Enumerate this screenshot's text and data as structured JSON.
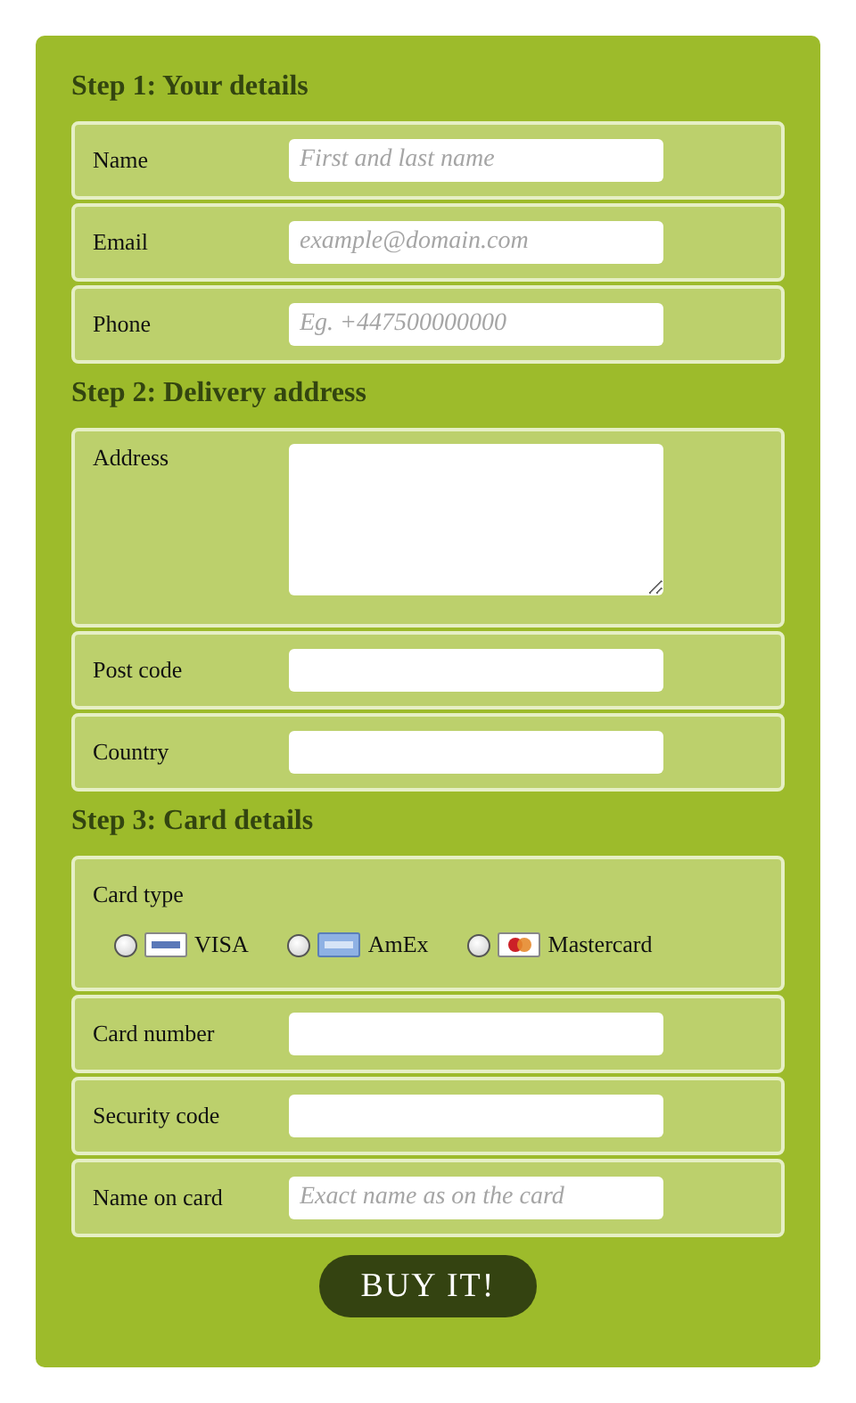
{
  "sections": [
    {
      "title": "Step 1: Your details",
      "rows": [
        {
          "kind": "text",
          "label": "Name",
          "placeholder": "First and last name"
        },
        {
          "kind": "text",
          "label": "Email",
          "placeholder": "example@domain.com"
        },
        {
          "kind": "text",
          "label": "Phone",
          "placeholder": "Eg. +447500000000"
        }
      ]
    },
    {
      "title": "Step 2: Delivery address",
      "rows": [
        {
          "kind": "textarea",
          "label": "Address"
        },
        {
          "kind": "text",
          "label": "Post code"
        },
        {
          "kind": "text",
          "label": "Country"
        }
      ]
    },
    {
      "title": "Step 3: Card details",
      "rows": [
        {
          "kind": "radio",
          "label": "Card type",
          "options": [
            {
              "label": "VISA",
              "kind": "visa",
              "selected": false
            },
            {
              "label": "AmEx",
              "kind": "amex",
              "selected": false
            },
            {
              "label": "Mastercard",
              "kind": "mastercard",
              "selected": false
            }
          ]
        },
        {
          "kind": "text",
          "label": "Card number"
        },
        {
          "kind": "text",
          "label": "Security code"
        },
        {
          "kind": "text",
          "label": "Name on card",
          "placeholder": "Exact name as on the card"
        }
      ]
    }
  ],
  "button": "BUY IT!"
}
